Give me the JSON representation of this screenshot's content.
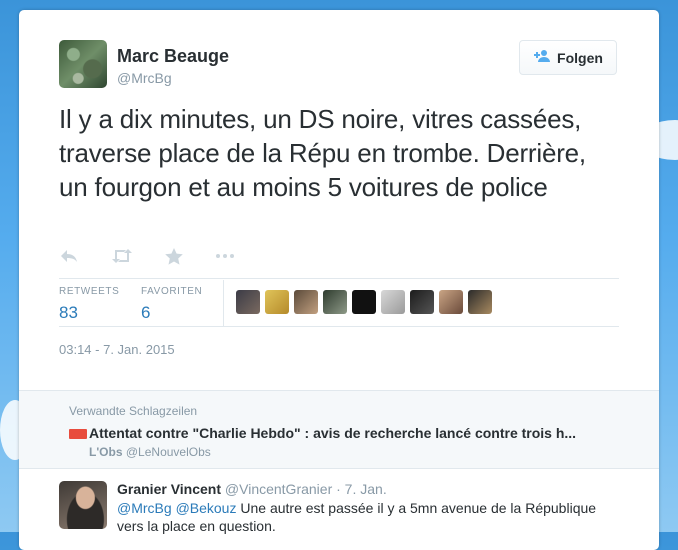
{
  "tweet": {
    "author_name": "Marc Beauge",
    "author_handle": "@MrcBg",
    "follow_label": "Folgen",
    "text": "Il y a dix minutes, un DS noire, vitres cassées, traverse place de la Répu en trombe. Derrière, un fourgon et au moins 5 voitures de police",
    "retweets_label": "RETWEETS",
    "retweets_count": "83",
    "favorites_label": "FAVORITEN",
    "favorites_count": "6",
    "timestamp": "03:14 - 7. Jan. 2015",
    "actions": [
      "reply-icon",
      "retweet-icon",
      "favorite-icon",
      "more-icon"
    ]
  },
  "related": {
    "heading": "Verwandte Schlagzeilen",
    "headline": "Attentat contre \"Charlie Hebdo\" : avis de recherche lancé contre trois h...",
    "source_name": "L'Obs",
    "source_handle": "@LeNouvelObs"
  },
  "reply": {
    "name": "Granier Vincent",
    "handle_date": "@VincentGranier · 7. Jan.",
    "mention1": "@MrcBg",
    "mention2": "@Bekouz",
    "text": " Une autre est passée il y a 5mn avenue de la République vers la place en question."
  },
  "colors": {
    "accent": "#55acee",
    "link": "#2b7bb9",
    "muted": "#8899a6"
  }
}
